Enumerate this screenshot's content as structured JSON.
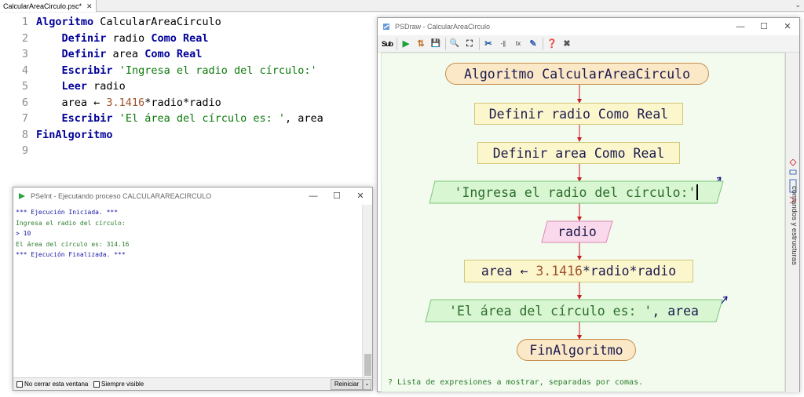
{
  "tab": {
    "label": "CalcularAreaCirculo.psc*",
    "close": "✕",
    "dropdown": "⌄"
  },
  "editor": {
    "lines": [
      {
        "n": "1",
        "segments": [
          {
            "t": "Algoritmo",
            "c": "kw"
          },
          {
            "t": " CalcularAreaCirculo",
            "c": ""
          }
        ]
      },
      {
        "n": "2",
        "segments": [
          {
            "t": "    ",
            "c": ""
          },
          {
            "t": "Definir",
            "c": "kw"
          },
          {
            "t": " radio ",
            "c": ""
          },
          {
            "t": "Como Real",
            "c": "kw"
          }
        ]
      },
      {
        "n": "3",
        "segments": [
          {
            "t": "    ",
            "c": ""
          },
          {
            "t": "Definir",
            "c": "kw"
          },
          {
            "t": " area ",
            "c": ""
          },
          {
            "t": "Como Real",
            "c": "kw"
          }
        ]
      },
      {
        "n": "4",
        "segments": [
          {
            "t": "    ",
            "c": ""
          },
          {
            "t": "Escribir",
            "c": "kw"
          },
          {
            "t": " ",
            "c": ""
          },
          {
            "t": "'Ingresa el radio del círculo:'",
            "c": "str"
          }
        ]
      },
      {
        "n": "5",
        "segments": [
          {
            "t": "    ",
            "c": ""
          },
          {
            "t": "Leer",
            "c": "kw"
          },
          {
            "t": " radio",
            "c": ""
          }
        ]
      },
      {
        "n": "6",
        "segments": [
          {
            "t": "    area ← ",
            "c": ""
          },
          {
            "t": "3.1416",
            "c": "num"
          },
          {
            "t": "*radio*radio",
            "c": ""
          }
        ]
      },
      {
        "n": "7",
        "segments": [
          {
            "t": "    ",
            "c": ""
          },
          {
            "t": "Escribir",
            "c": "kw"
          },
          {
            "t": " ",
            "c": ""
          },
          {
            "t": "'El área del círculo es: '",
            "c": "str"
          },
          {
            "t": ", area",
            "c": ""
          }
        ]
      },
      {
        "n": "8",
        "segments": [
          {
            "t": "FinAlgoritmo",
            "c": "kw"
          }
        ]
      },
      {
        "n": "9",
        "segments": []
      }
    ]
  },
  "console": {
    "title": "PSeInt - Ejecutando proceso CALCULARAREACIRCULO",
    "min": "—",
    "max": "☐",
    "close": "✕",
    "lines": [
      {
        "text": "*** Ejecución Iniciada. ***",
        "c": "c-blue"
      },
      {
        "text": "Ingresa el radio del círculo:",
        "c": "c-green"
      },
      {
        "text": "> 10",
        "c": "c-blue"
      },
      {
        "text": "El área del círculo es: 314.16",
        "c": "c-green"
      },
      {
        "text": "*** Ejecución Finalizada. ***",
        "c": "c-blue"
      }
    ],
    "no_cerrar_label": "No cerrar esta ventana",
    "siempre_visible_label": "Siempre visible",
    "reiniciar_label": "Reiniciar",
    "reiniciar_arrow": "⌄"
  },
  "psdraw": {
    "title": "PSDraw - CalcularAreaCirculo",
    "min": "—",
    "max": "☐",
    "close": "✕",
    "toolbar": [
      "Sub",
      "▶",
      "⇅",
      "💾",
      "🔍",
      "⛶",
      "✂",
      "-∥",
      "tx",
      "✎",
      "❓",
      "✖"
    ],
    "side_label": "comandos y estructuras",
    "hint": "? Lista de expresiones a mostrar, separadas por comas.",
    "nodes": {
      "start": "Algoritmo CalcularAreaCirculo",
      "def_radio": "Definir radio Como Real",
      "def_area": "Definir area Como Real",
      "escribir1": "'Ingresa el radio del círculo:'",
      "leer": "radio",
      "assign_lhs": "area ← ",
      "assign_num": "3.1416",
      "assign_rhs": "*radio*radio",
      "escribir2_str": "'El área del círculo es: '",
      "escribir2_rest": ", area",
      "end": "FinAlgoritmo"
    }
  },
  "colors": {
    "keyword": "#00009a",
    "string": "#0a7a0a",
    "number": "#a0522d",
    "arrow": "#c81e1e",
    "canvas": "#f3fbef"
  }
}
